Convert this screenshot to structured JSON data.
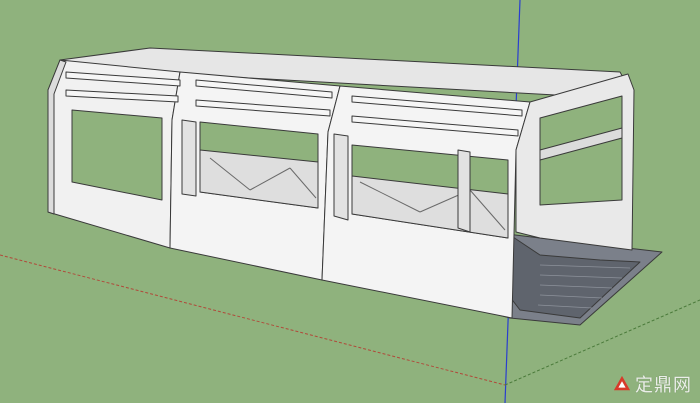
{
  "viewport": {
    "background_color": "#8fb27d",
    "axes": {
      "blue_axis_color": "#2a3ecf",
      "red_axis_color": "#b04a3a",
      "green_axis_color": "#4a7a3a"
    },
    "model": {
      "description_icon": "shelter-model-icon",
      "face_color": "#f1f1f1",
      "shade_color": "#dcdcdc",
      "floor_color": "#6a6f78",
      "edge_color": "#3a3a3a"
    }
  },
  "watermark": {
    "brand_text": "定鼎网",
    "logo_icon": "dingding-logo-icon",
    "logo_color": "#d83a2a"
  }
}
